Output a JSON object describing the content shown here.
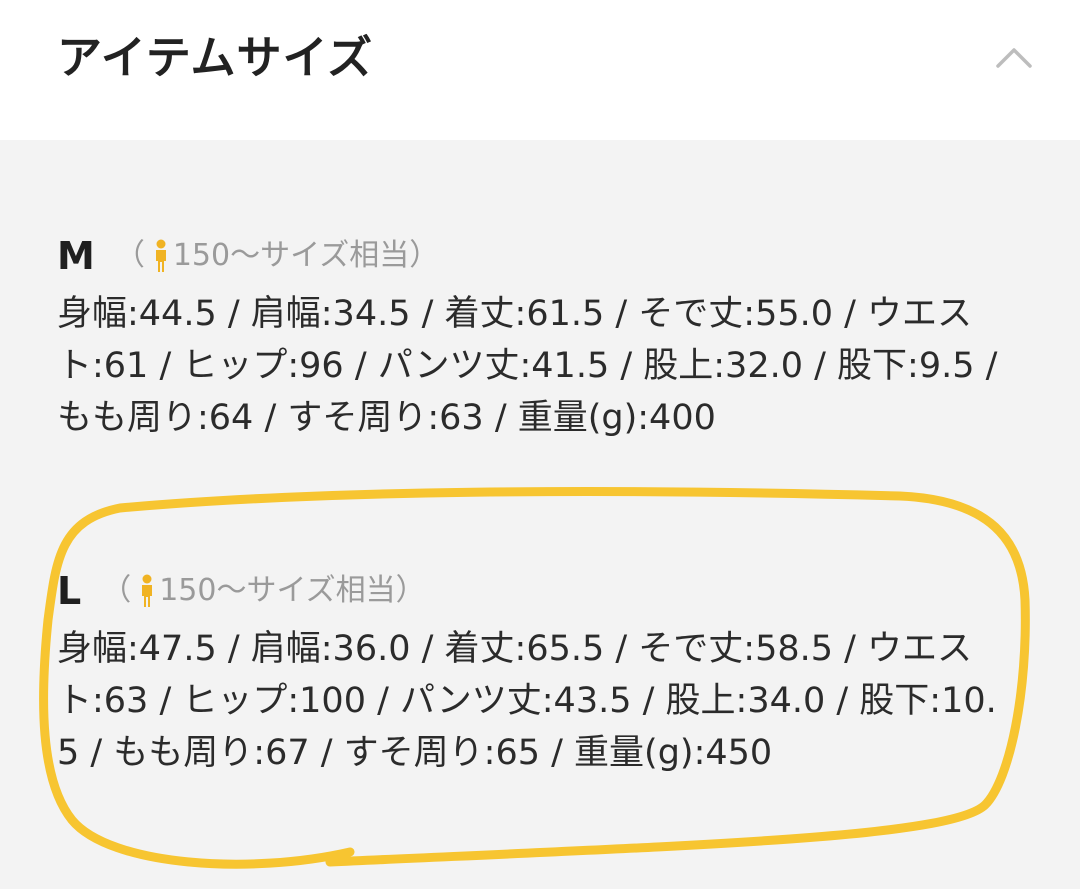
{
  "section": {
    "title": "アイテムサイズ",
    "collapse_icon": "chevron-up-icon"
  },
  "sizes": [
    {
      "name": "M",
      "note_open": "（",
      "note_text": "150〜サイズ相当",
      "note_close": "）",
      "person_icon": "person-icon",
      "description": "身幅:44.5 / 肩幅:34.5 / 着丈:61.5 / そで丈:55.0 / ウエスト:61 / ヒップ:96 / パンツ丈:41.5 / 股上:32.0 / 股下:9.5 / もも周り:64 / すそ周り:63 / 重量(g):400"
    },
    {
      "name": "L",
      "note_open": "（",
      "note_text": "150〜サイズ相当",
      "note_close": "）",
      "person_icon": "person-icon",
      "description": "身幅:47.5 / 肩幅:36.0 / 着丈:65.5 / そで丈:58.5 / ウエスト:63 / ヒップ:100 / パンツ丈:43.5 / 股上:34.0 / 股下:10.5 / もも周り:67 / すそ周り:65 / 重量(g):450"
    }
  ],
  "colors": {
    "header_bg": "#ffffff",
    "body_bg": "#f3f3f3",
    "person_icon": "#f0b323",
    "highlight_stroke": "#f7c531"
  }
}
